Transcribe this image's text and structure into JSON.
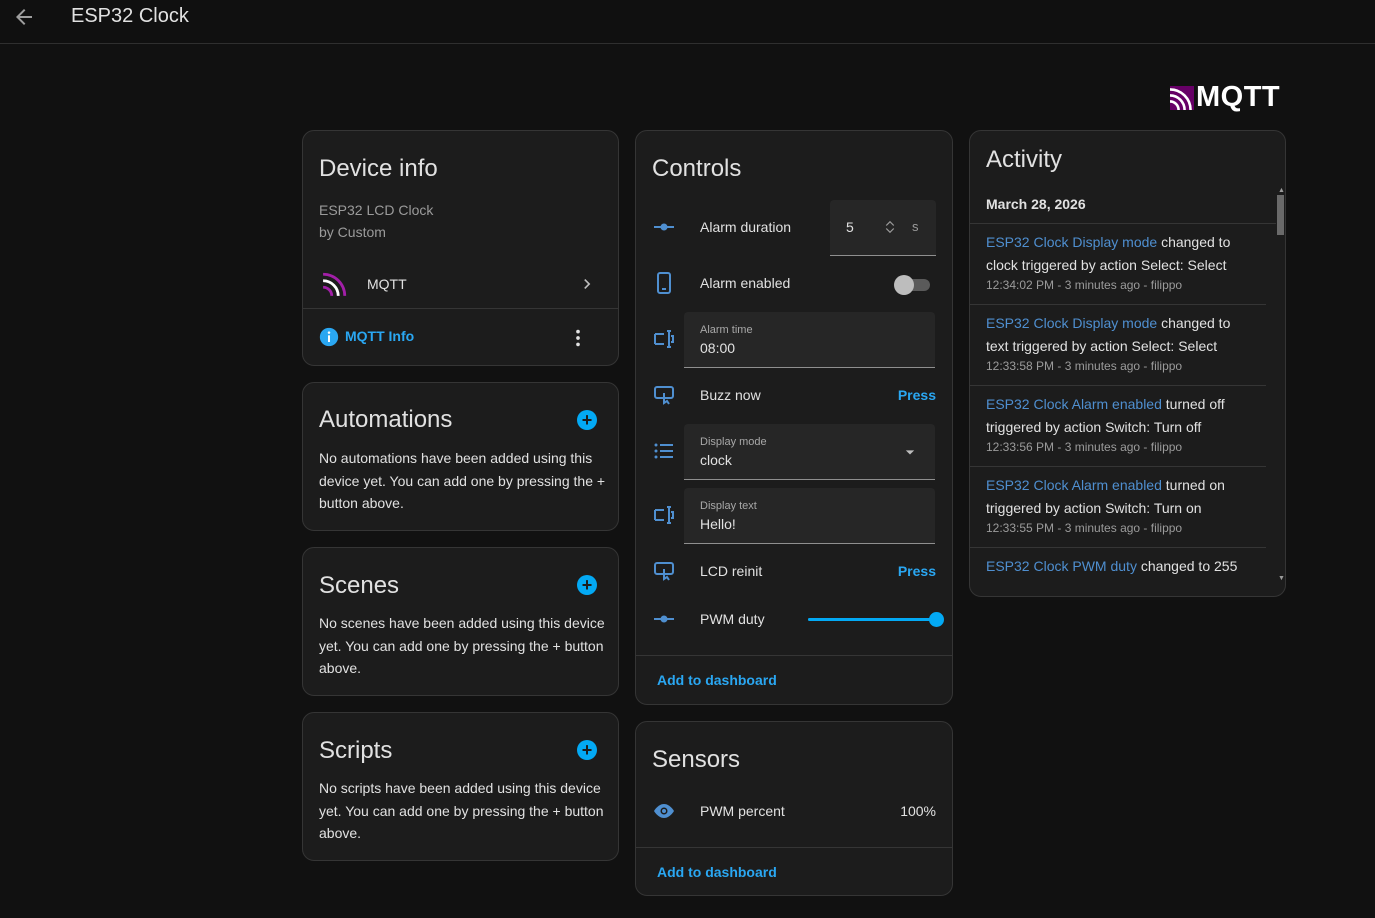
{
  "header": {
    "title": "ESP32 Clock"
  },
  "brand": {
    "logo_text": "MQTT",
    "accent": "#a21fa8"
  },
  "device_info": {
    "title": "Device info",
    "model": "ESP32 LCD Clock",
    "manufacturer": "by Custom",
    "integration": "MQTT",
    "info_link": "MQTT Info"
  },
  "automations": {
    "title": "Automations",
    "empty_text": "No automations have been added using this device yet. You can add one by pressing the + button above."
  },
  "scenes": {
    "title": "Scenes",
    "empty_text": "No scenes have been added using this device yet. You can add one by pressing the + button above."
  },
  "scripts": {
    "title": "Scripts",
    "empty_text": "No scripts have been added using this device yet. You can add one by pressing the + button above."
  },
  "controls": {
    "title": "Controls",
    "alarm_duration": {
      "label": "Alarm duration",
      "value": "5",
      "unit": "s"
    },
    "alarm_enabled": {
      "label": "Alarm enabled",
      "state": "off"
    },
    "alarm_time": {
      "label": "Alarm time",
      "value": "08:00"
    },
    "buzz_now": {
      "label": "Buzz now",
      "action": "Press"
    },
    "display_mode": {
      "label": "Display mode",
      "value": "clock"
    },
    "display_text": {
      "label": "Display text",
      "value": "Hello!"
    },
    "lcd_reinit": {
      "label": "LCD reinit",
      "action": "Press"
    },
    "pwm_duty": {
      "label": "PWM duty",
      "level": 1.0
    },
    "add_to_dashboard": "Add to dashboard"
  },
  "sensors": {
    "title": "Sensors",
    "pwm_percent": {
      "label": "PWM percent",
      "value": "100%"
    },
    "add_to_dashboard": "Add to dashboard"
  },
  "activity": {
    "title": "Activity",
    "date": "March 28, 2026",
    "entries": [
      {
        "entity": "ESP32 Clock Display mode",
        "rest": " changed to clock triggered by action Select: Select",
        "meta": "12:34:02 PM - 3 minutes ago - filippo"
      },
      {
        "entity": "ESP32 Clock Display mode",
        "rest": " changed to text triggered by action Select: Select",
        "meta": "12:33:58 PM - 3 minutes ago - filippo"
      },
      {
        "entity": "ESP32 Clock Alarm enabled",
        "rest": " turned off triggered by action Switch: Turn off",
        "meta": "12:33:56 PM - 3 minutes ago - filippo"
      },
      {
        "entity": "ESP32 Clock Alarm enabled",
        "rest": " turned on triggered by action Switch: Turn on",
        "meta": "12:33:55 PM - 3 minutes ago - filippo"
      },
      {
        "entity": "ESP32 Clock PWM duty",
        "rest": " changed to 255",
        "meta": ""
      }
    ]
  }
}
